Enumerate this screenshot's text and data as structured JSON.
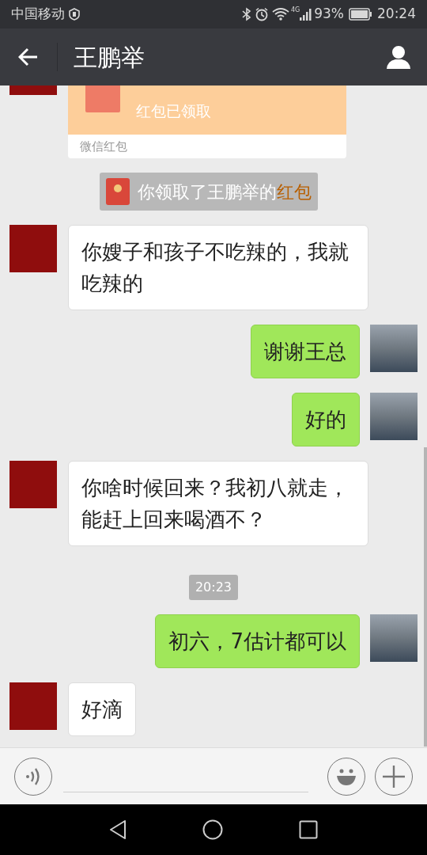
{
  "status_bar": {
    "carrier": "中国移动",
    "network": "4G",
    "battery": "93%",
    "time": "20:24"
  },
  "header": {
    "title": "王鹏举"
  },
  "messages": [
    {
      "kind": "money_envelope",
      "outgoing": false,
      "status": "红包已领取",
      "footer": "微信红包"
    },
    {
      "kind": "notice",
      "text": "你领取了王鹏举的",
      "link": "红包"
    },
    {
      "kind": "text",
      "outgoing": false,
      "text": "你嫂子和孩子不吃辣的，我就吃辣的"
    },
    {
      "kind": "text",
      "outgoing": true,
      "text": "谢谢王总"
    },
    {
      "kind": "text",
      "outgoing": true,
      "text": "好的"
    },
    {
      "kind": "text",
      "outgoing": false,
      "text": "你啥时候回来？我初八就走，能赶上回来喝酒不？"
    },
    {
      "kind": "time",
      "text": "20:23"
    },
    {
      "kind": "text",
      "outgoing": true,
      "text": "初六，7估计都可以"
    },
    {
      "kind": "text",
      "outgoing": false,
      "text": "好滴"
    }
  ]
}
